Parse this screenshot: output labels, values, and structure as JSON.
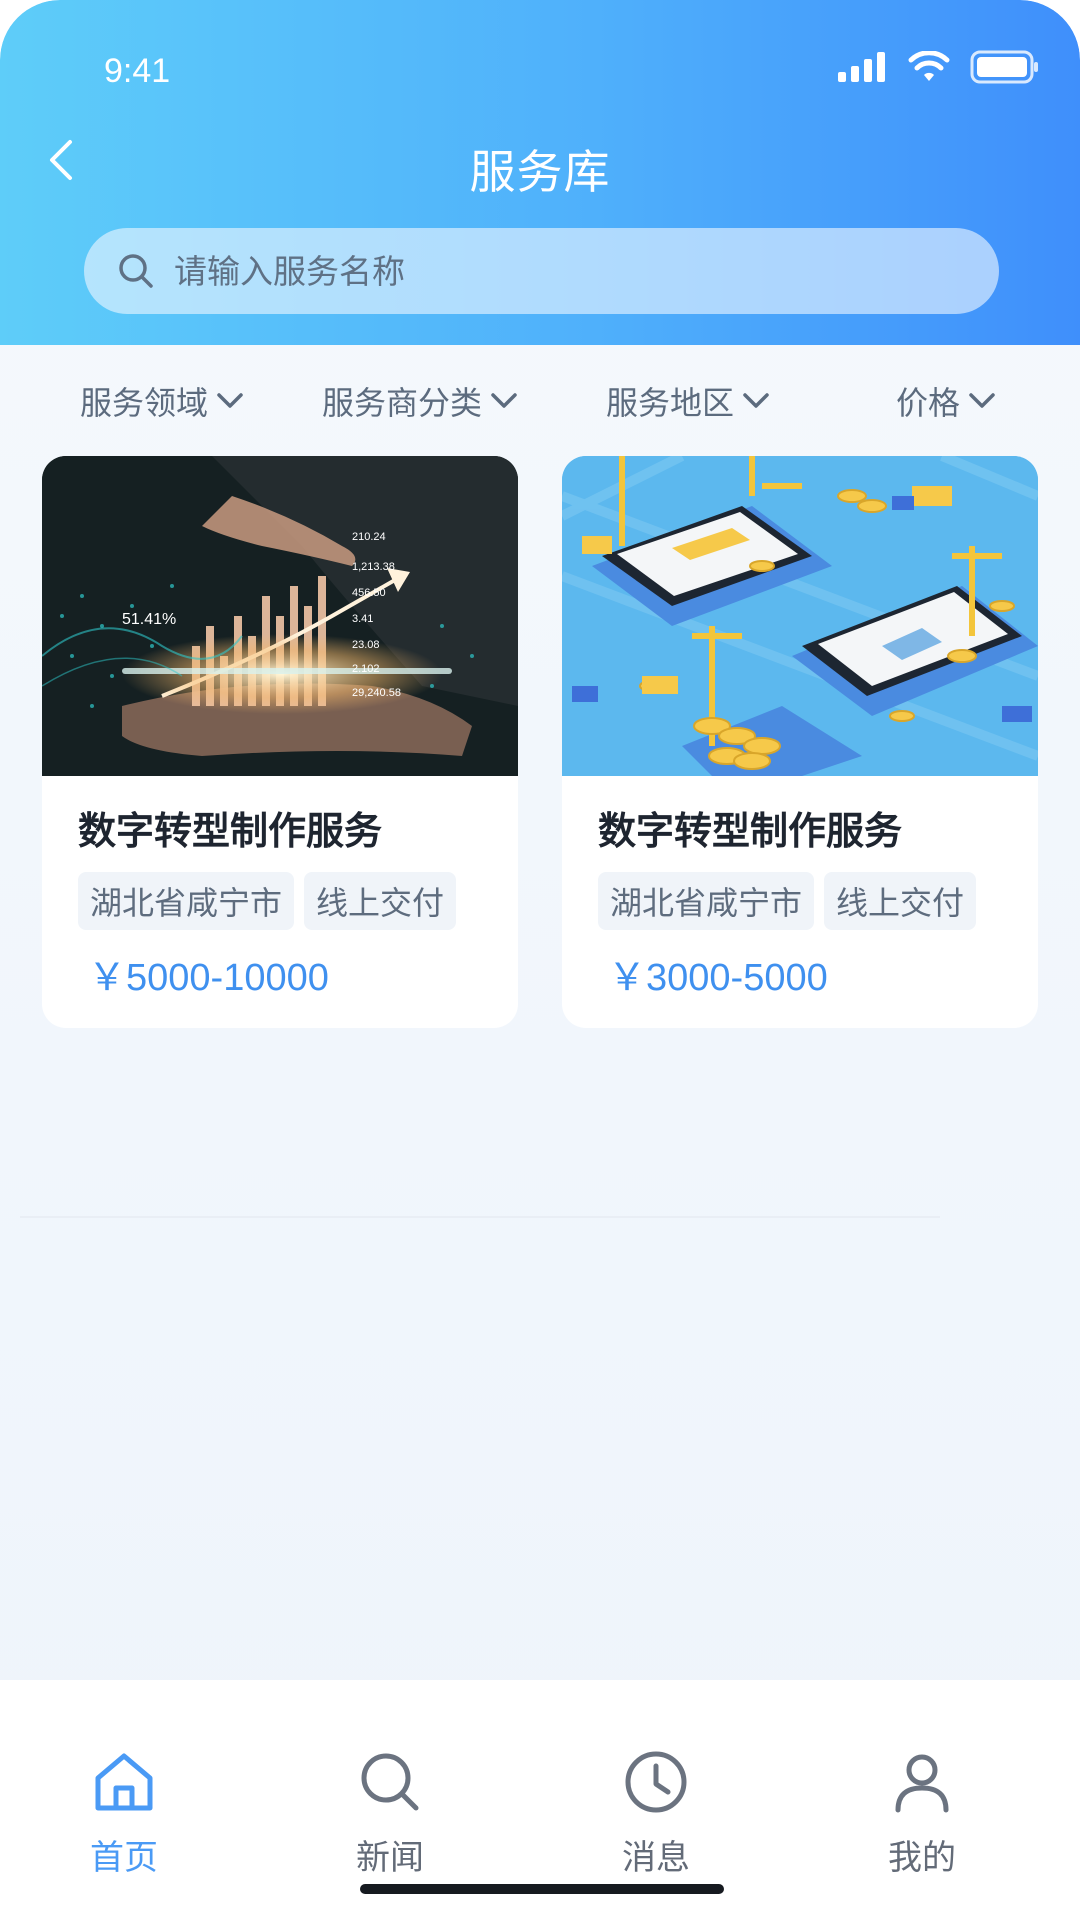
{
  "status_bar": {
    "time": "9:41"
  },
  "header": {
    "title": "服务库"
  },
  "search": {
    "placeholder": "请输入服务名称"
  },
  "filters": [
    {
      "label": "服务领域"
    },
    {
      "label": "服务商分类"
    },
    {
      "label": "服务地区"
    },
    {
      "label": "价格"
    }
  ],
  "cards": [
    {
      "title": "数字转型制作服务",
      "tags": [
        "湖北省咸宁市",
        "线上交付"
      ],
      "price": "￥5000-10000",
      "image_overlay": {
        "percent": "51.41%",
        "values": [
          "210.24",
          "1,213.38",
          "456.50",
          "3.41",
          "23.08",
          "2.102",
          "29,240.58"
        ]
      }
    },
    {
      "title": "数字转型制作服务",
      "tags": [
        "湖北省咸宁市",
        "线上交付"
      ],
      "price": "￥3000-5000"
    }
  ],
  "bottom_nav": [
    {
      "label": "首页",
      "icon": "home-icon",
      "active": true
    },
    {
      "label": "新闻",
      "icon": "search-icon",
      "active": false
    },
    {
      "label": "消息",
      "icon": "clock-icon",
      "active": false
    },
    {
      "label": "我的",
      "icon": "user-icon",
      "active": false
    }
  ],
  "colors": {
    "accent": "#4a9af5",
    "price": "#3f90ef",
    "header_start": "#5ecdf9",
    "header_end": "#3f8ffb"
  }
}
